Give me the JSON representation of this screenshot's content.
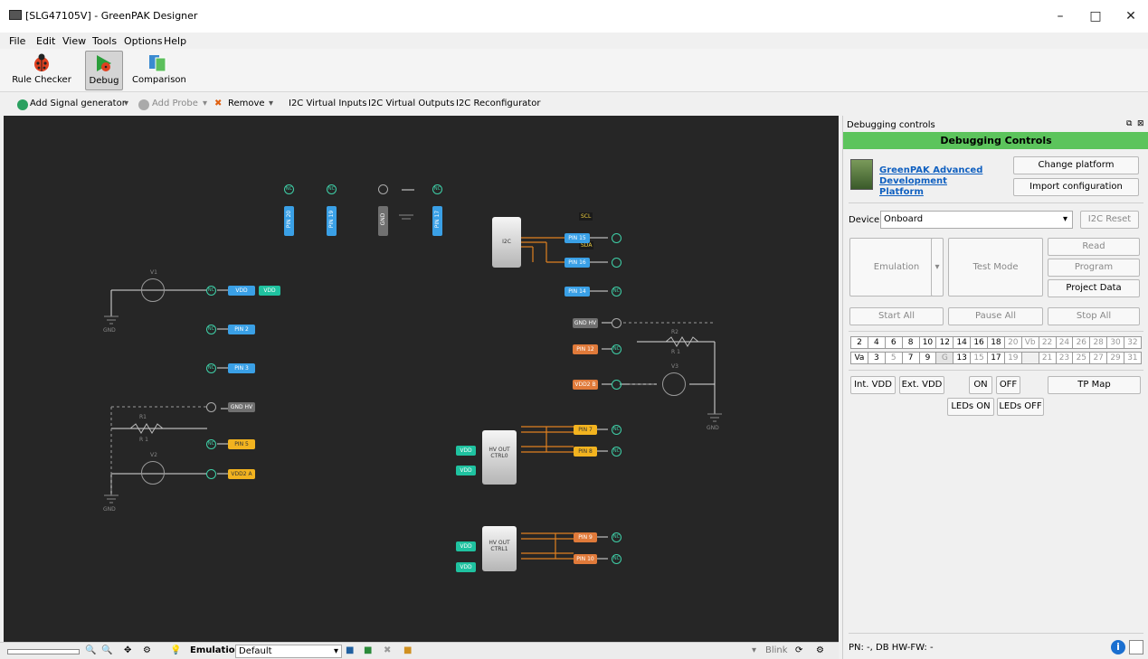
{
  "window": {
    "title": "[SLG47105V] - GreenPAK Designer",
    "minimize": "–",
    "maximize": "□",
    "close": "✕"
  },
  "menu": [
    "File",
    "Edit",
    "View",
    "Tools",
    "Options",
    "Help"
  ],
  "ribbon": {
    "rule_checker": "Rule Checker",
    "debug": "Debug",
    "comparison": "Comparison"
  },
  "toolbar": {
    "add_signal": "Add Signal generator",
    "add_probe": "Add Probe",
    "remove": "Remove",
    "i2c_inputs": "I2C Virtual Inputs",
    "i2c_outputs": "I2C Virtual Outputs",
    "i2c_reconf": "I2C Reconfigurator"
  },
  "canvas": {
    "v1": "V1",
    "v2": "V2",
    "v3": "V3",
    "r1": "R1",
    "r2": "R2",
    "r1v": "R 1",
    "r2v": "R 1",
    "gnd": "GND",
    "nc": "NC",
    "pin_vdd": "VDD",
    "vdd_tag": "VDD",
    "pin2": "PIN 2",
    "pin3": "PIN 3",
    "gndhv_left": "GND HV",
    "pin5": "PIN 5",
    "vdd2a": "VDD2 A",
    "pin20": "PIN 20",
    "pin19": "PIN 19",
    "pin_gnd_top": "GND",
    "pin17": "PIN 17",
    "i2c": "I2C",
    "scl": "SCL",
    "sda": "SDA",
    "pin15": "PIN 15",
    "pin16": "PIN 16",
    "pin14": "PIN 14",
    "gndhv_right": "GND HV",
    "pin12": "PIN 12",
    "vdd2b": "VDD2 B",
    "hv0": "HV OUT CTRL0",
    "hv1": "HV OUT CTRL1",
    "pin7": "PIN 7",
    "pin8": "PIN 8",
    "pin9": "PIN 9",
    "pin10": "PIN 10",
    "vdd": "VDD"
  },
  "status": {
    "emulation_label": "Emulation:",
    "emulation_value": "Default",
    "blink": "Blink"
  },
  "panel": {
    "title": "Debugging controls",
    "header": "Debugging Controls",
    "platform_link": "GreenPAK Advanced Development Platform",
    "change_platform": "Change platform",
    "import_config": "Import configuration",
    "device_label": "Device:",
    "device_value": "Onboard",
    "i2c_reset": "I2C Reset",
    "emulation": "Emulation",
    "test_mode": "Test Mode",
    "read": "Read",
    "program": "Program",
    "project_data": "Project Data",
    "start_all": "Start All",
    "pause_all": "Pause All",
    "stop_all": "Stop All",
    "row1": [
      "2",
      "4",
      "6",
      "8",
      "10",
      "12",
      "14",
      "16",
      "18",
      "20",
      "Vb",
      "22",
      "24",
      "26",
      "28",
      "30",
      "32"
    ],
    "row2": [
      "Va",
      "3",
      "5",
      "7",
      "9",
      "G",
      "13",
      "15",
      "17",
      "19",
      "",
      "21",
      "23",
      "25",
      "27",
      "29",
      "31"
    ],
    "int_vdd": "Int. VDD",
    "ext_vdd": "Ext. VDD",
    "on": "ON",
    "off": "OFF",
    "tp_map": "TP Map",
    "leds_on": "LEDs ON",
    "leds_off": "LEDs OFF",
    "fw": "PN: -, DB HW-FW: -"
  }
}
